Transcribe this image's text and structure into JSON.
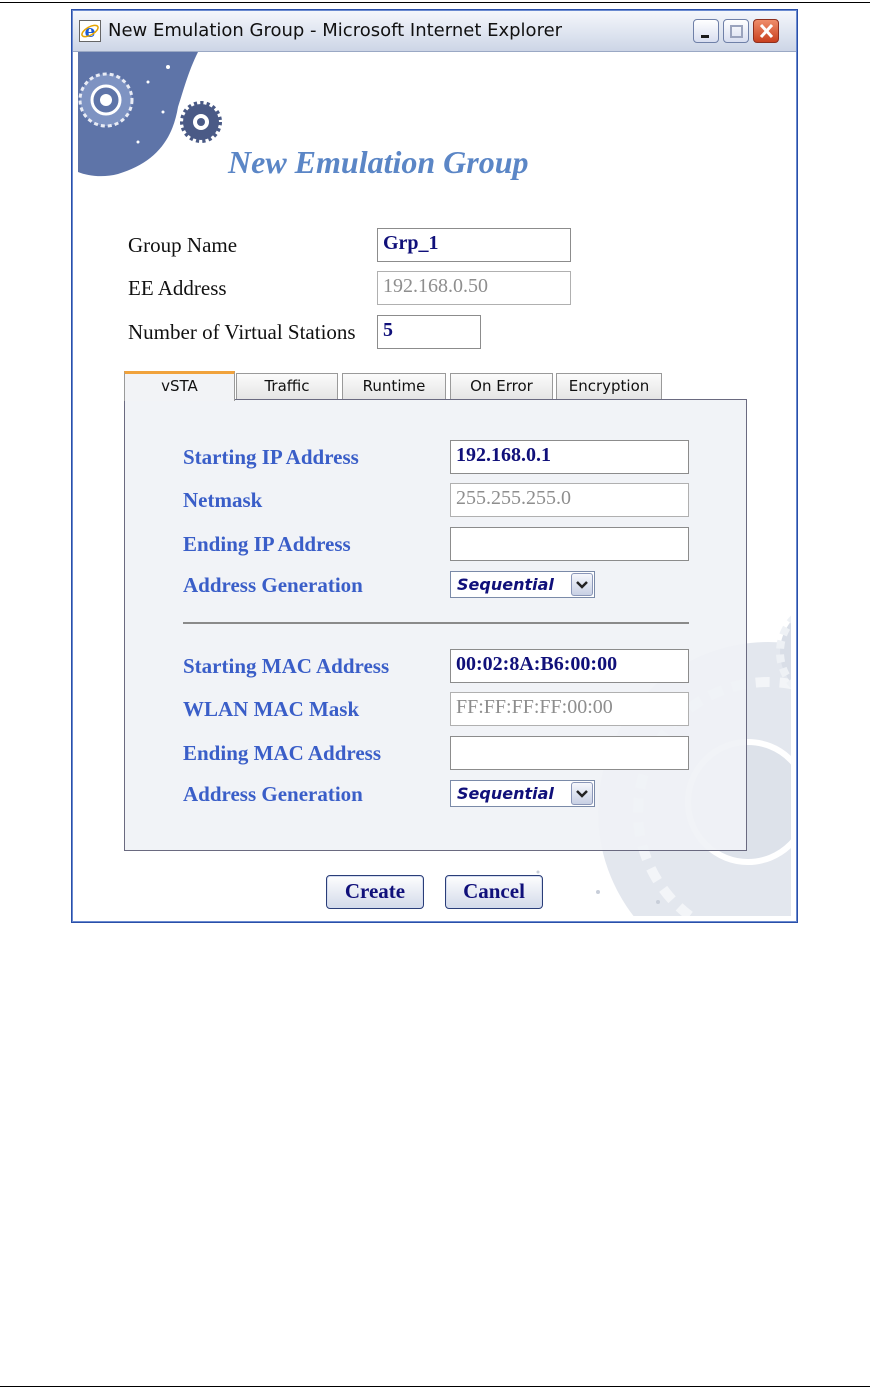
{
  "window": {
    "title": "New Emulation Group - Microsoft Internet Explorer"
  },
  "page": {
    "heading": "New Emulation Group"
  },
  "form": {
    "group_name_label": "Group Name",
    "group_name_value": "Grp_1",
    "ee_address_label": "EE Address",
    "ee_address_value": "192.168.0.50",
    "num_stations_label": "Number of Virtual Stations",
    "num_stations_value": "5"
  },
  "tabs": [
    {
      "label": "vSTA",
      "active": true
    },
    {
      "label": "Traffic",
      "active": false
    },
    {
      "label": "Runtime",
      "active": false
    },
    {
      "label": "On Error",
      "active": false
    },
    {
      "label": "Encryption",
      "active": false
    }
  ],
  "vsta": {
    "starting_ip_label": "Starting IP Address",
    "starting_ip_value": "192.168.0.1",
    "netmask_label": "Netmask",
    "netmask_value": "255.255.255.0",
    "ending_ip_label": "Ending IP Address",
    "ending_ip_value": "",
    "ip_gen_label": "Address Generation",
    "ip_gen_value": "Sequential",
    "starting_mac_label": "Starting MAC Address",
    "starting_mac_value": "00:02:8A:B6:00:00",
    "wlan_mask_label": "WLAN MAC Mask",
    "wlan_mask_value": "FF:FF:FF:FF:00:00",
    "ending_mac_label": "Ending MAC Address",
    "ending_mac_value": "",
    "mac_gen_label": "Address Generation",
    "mac_gen_value": "Sequential"
  },
  "buttons": {
    "create": "Create",
    "cancel": "Cancel"
  },
  "icons": {
    "app": "internet-explorer-icon",
    "minimize": "minimize-icon",
    "maximize": "maximize-icon",
    "close": "close-icon",
    "dropdown": "chevron-down-icon",
    "decor": "gears-icon"
  },
  "colors": {
    "heading": "#5b86c6",
    "field_label": "#3a5ec8",
    "value_text": "#10107a",
    "active_tab_accent": "#f0a23c"
  }
}
